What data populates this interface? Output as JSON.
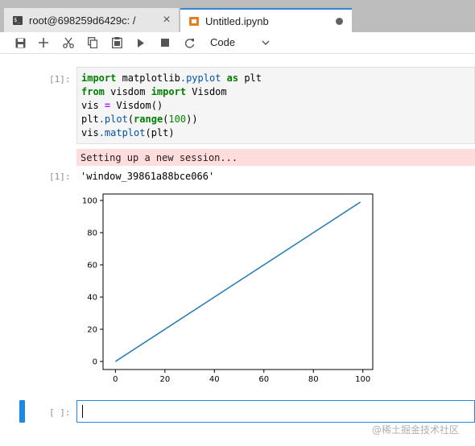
{
  "tabs": [
    {
      "label": "root@698259d6429c: /",
      "icon": "terminal-icon",
      "close": "×"
    },
    {
      "label": "Untitled.ipynb",
      "icon": "notebook-icon"
    }
  ],
  "toolbar": {
    "kernel_mode": "Code",
    "buttons": [
      "save-icon",
      "add-icon",
      "cut-icon",
      "copy-icon",
      "paste-icon",
      "run-icon",
      "stop-icon",
      "restart-icon"
    ]
  },
  "cells": {
    "input_prompt": "[1]:",
    "code": [
      "import matplotlib.pyplot as plt",
      "from visdom import Visdom",
      "vis = Visdom()",
      "plt.plot(range(100))",
      "vis.matplot(plt)"
    ],
    "stderr": "Setting up a new session...",
    "output_prompt": "[1]:",
    "output_text": "'window_39861a88bce066'",
    "empty_prompt": "[ ]:"
  },
  "chart_data": {
    "type": "line",
    "title": "",
    "xlabel": "",
    "ylabel": "",
    "xlim": [
      -5,
      104
    ],
    "ylim": [
      -5,
      104
    ],
    "xticks": [
      0,
      20,
      40,
      60,
      80,
      100
    ],
    "yticks": [
      0,
      20,
      40,
      60,
      80,
      100
    ],
    "series": [
      {
        "x": [
          0,
          99
        ],
        "y": [
          0,
          99
        ],
        "color": "#1f77b4"
      }
    ],
    "grid": false
  },
  "colors": {
    "accent": "#1e88e5",
    "stderr_bg": "#ffdddd",
    "line": "#1f77b4"
  },
  "watermark": "@稀土掘金技术社区"
}
